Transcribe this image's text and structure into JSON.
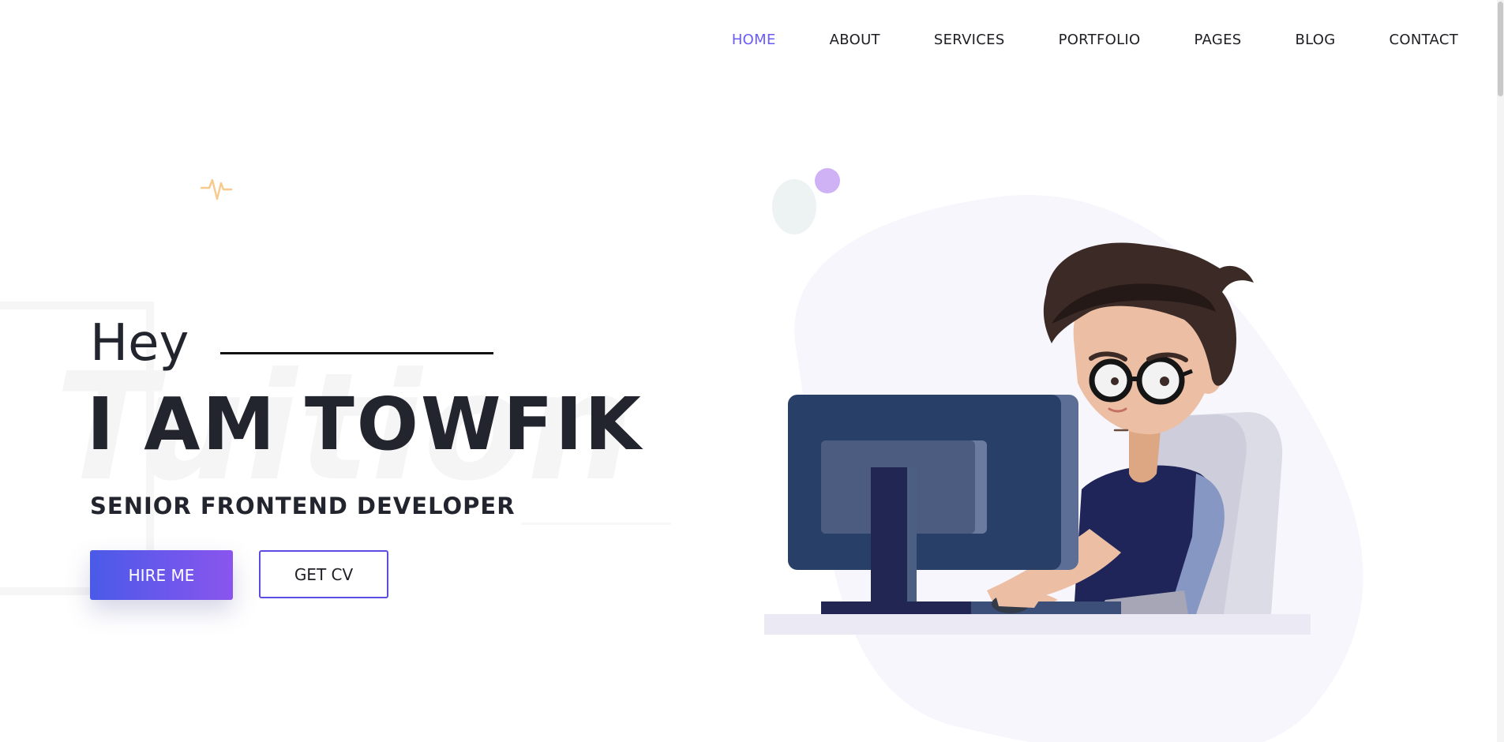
{
  "nav": {
    "items": [
      {
        "label": "HOME",
        "active": true
      },
      {
        "label": "ABOUT",
        "active": false
      },
      {
        "label": "SERVICES",
        "active": false
      },
      {
        "label": "PORTFOLIO",
        "active": false
      },
      {
        "label": "PAGES",
        "active": false
      },
      {
        "label": "BLOG",
        "active": false
      },
      {
        "label": "CONTACT",
        "active": false
      }
    ]
  },
  "hero": {
    "greeting": "Hey",
    "headline": "I AM TOWFIK",
    "subtitle": "SENIOR FRONTEND DEVELOPER",
    "watermark": "Tuition",
    "hire_label": "HIRE ME",
    "cv_label": "GET CV"
  },
  "colors": {
    "accent": "#6a5af9",
    "button_gradient_start": "#4a5ae8",
    "button_gradient_end": "#8a55ee",
    "pulse_icon": "#f7c98a",
    "blob": "#f7f6fd"
  },
  "icons": {
    "pulse": "pulse-icon",
    "illustration": "developer-at-computer-illustration"
  }
}
